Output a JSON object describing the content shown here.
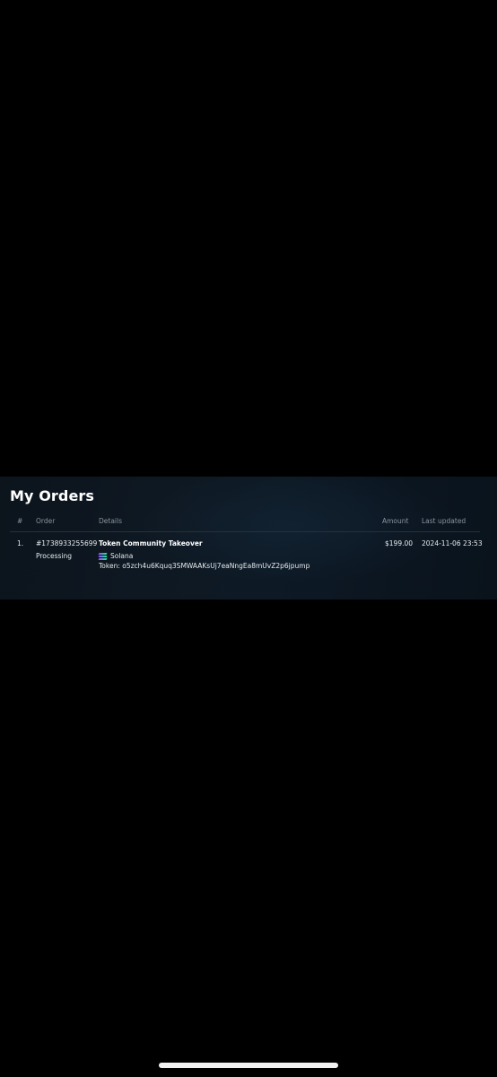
{
  "page": {
    "title": "My Orders"
  },
  "table": {
    "headers": {
      "num": "#",
      "order": "Order",
      "details": "Details",
      "amount": "Amount",
      "updated": "Last updated"
    },
    "rows": [
      {
        "num": "1.",
        "order_id": "#1738933255699",
        "status": "Processing",
        "detail_title": "Token Community Takeover",
        "chain": "Solana",
        "chain_icon": "solana-icon",
        "token_text": "Token:  o5zch4u6Kquq3SMWAAKsUj7eaNngEa8mUvZ2p6jpump",
        "amount": "$199.00",
        "updated": "2024-11-06 23:53"
      }
    ]
  },
  "colors": {
    "background": "#000000",
    "panel": "#0d1822",
    "header_text": "#8a949e",
    "text": "#e6eaee",
    "solana_gradient": [
      "#9945ff",
      "#14f195"
    ]
  }
}
